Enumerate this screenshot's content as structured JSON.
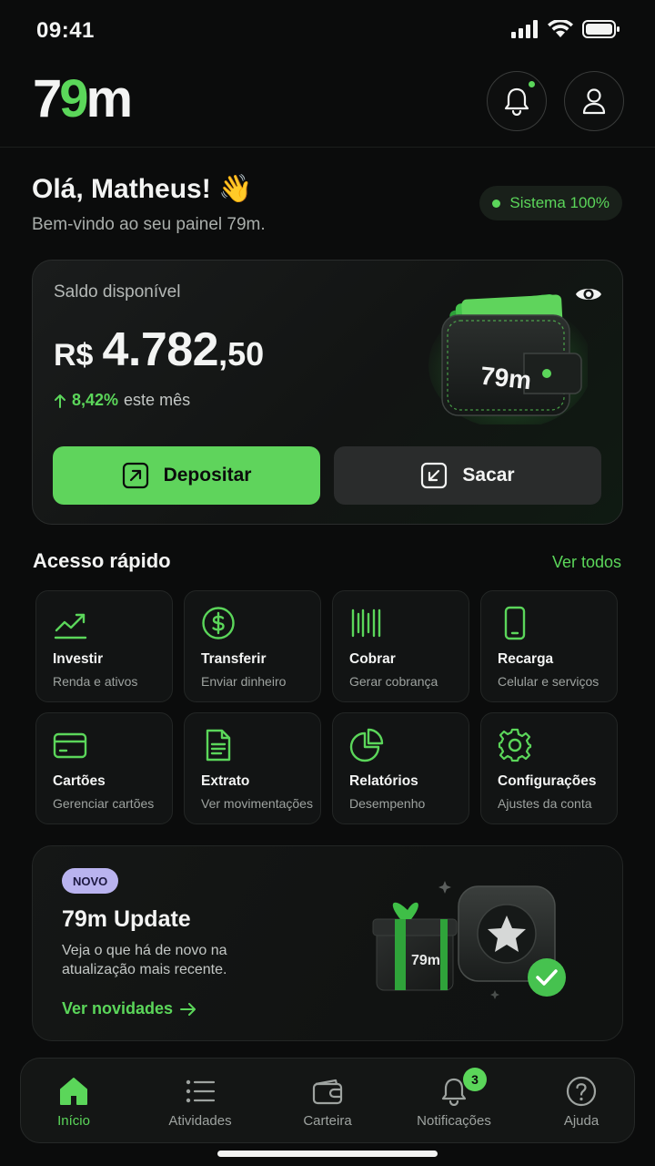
{
  "status_bar": {
    "time": "09:41"
  },
  "header": {
    "logo": {
      "seven": "7",
      "nine": "9",
      "m": "m"
    },
    "notification_icon": "bell-icon",
    "profile_icon": "user-icon"
  },
  "greeting": {
    "title": "Olá, Matheus! 👋",
    "subtitle": "Bem-vindo ao seu painel 79m.",
    "system_status": "Sistema 100%"
  },
  "balance": {
    "label": "Saldo disponível",
    "currency": "R$",
    "integer": "4.782",
    "decimal": ",50",
    "change_pct": "8,42%",
    "change_text": "este mês",
    "wallet_brand": "79m",
    "deposit_label": "Depositar",
    "withdraw_label": "Sacar"
  },
  "quick_access": {
    "title": "Acesso rápido",
    "see_all": "Ver todos",
    "items": [
      {
        "title": "Investir",
        "subtitle": "Renda e ativos",
        "icon": "trending-up-icon"
      },
      {
        "title": "Transferir",
        "subtitle": "Enviar dinheiro",
        "icon": "dollar-icon"
      },
      {
        "title": "Cobrar",
        "subtitle": "Gerar cobrança",
        "icon": "barcode-icon"
      },
      {
        "title": "Recarga",
        "subtitle": "Celular e serviços",
        "icon": "phone-icon"
      },
      {
        "title": "Cartões",
        "subtitle": "Gerenciar cartões",
        "icon": "card-icon"
      },
      {
        "title": "Extrato",
        "subtitle": "Ver movimentações",
        "icon": "document-icon"
      },
      {
        "title": "Relatórios",
        "subtitle": "Desempenho",
        "icon": "pie-chart-icon"
      },
      {
        "title": "Configurações",
        "subtitle": "Ajustes da conta",
        "icon": "gear-icon"
      }
    ]
  },
  "promo": {
    "badge": "NOVO",
    "title": "79m Update",
    "text": "Veja o que há de novo na atualização mais recente.",
    "link": "Ver novidades",
    "gift_brand": "79m"
  },
  "tabbar": {
    "items": [
      {
        "label": "Início",
        "icon": "home-icon"
      },
      {
        "label": "Atividades",
        "icon": "list-icon"
      },
      {
        "label": "Carteira",
        "icon": "wallet-icon"
      },
      {
        "label": "Notificações",
        "icon": "bell-icon",
        "badge": "3"
      },
      {
        "label": "Ajuda",
        "icon": "help-icon"
      }
    ]
  },
  "colors": {
    "accent": "#5bd65a",
    "background": "#0b0c0c",
    "badge": "#b9b3ef"
  }
}
